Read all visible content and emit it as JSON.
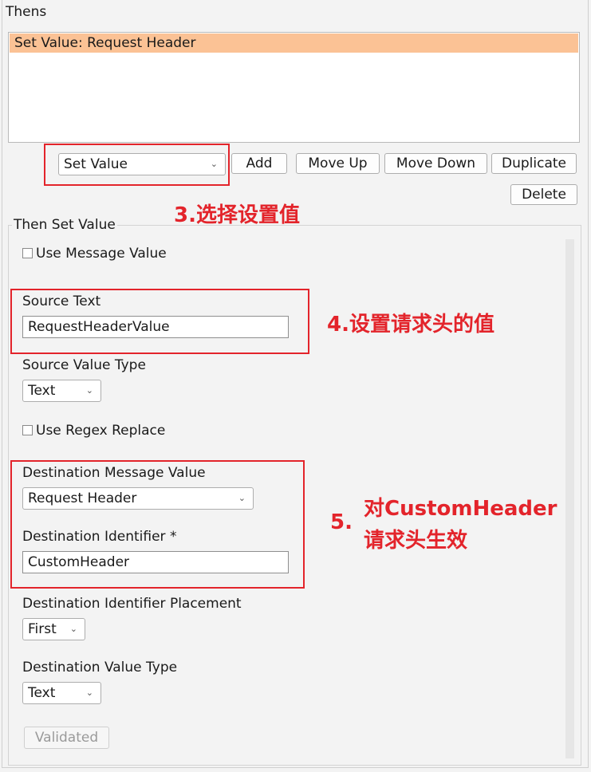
{
  "thens": {
    "title": "Thens",
    "items": [
      "Set Value: Request Header"
    ]
  },
  "toolbar": {
    "action_select": "Set Value",
    "add_label": "Add",
    "move_up_label": "Move Up",
    "move_down_label": "Move Down",
    "duplicate_label": "Duplicate",
    "delete_label": "Delete"
  },
  "then_set_value": {
    "title": "Then Set Value",
    "use_message_value_label": "Use Message Value",
    "source_text_label": "Source Text",
    "source_text_value": "RequestHeaderValue",
    "source_value_type_label": "Source Value Type",
    "source_value_type": "Text",
    "use_regex_replace_label": "Use Regex Replace",
    "destination_message_value_label": "Destination Message Value",
    "destination_message_value": "Request Header",
    "destination_identifier_label": "Destination Identifier *",
    "destination_identifier_value": "CustomHeader",
    "destination_identifier_placement_label": "Destination Identifier Placement",
    "destination_identifier_placement": "First",
    "destination_value_type_label": "Destination Value Type",
    "destination_value_type": "Text",
    "validated_label": "Validated"
  },
  "annotations": {
    "step3": "3.选择设置值",
    "step4": "4.设置请求头的值",
    "step5_num": "5.",
    "step5_line1": "对CustomHeader",
    "step5_line2": "请求头生效"
  },
  "colors": {
    "selected_row": "#fbc295",
    "annotation_red": "#e3242b"
  }
}
